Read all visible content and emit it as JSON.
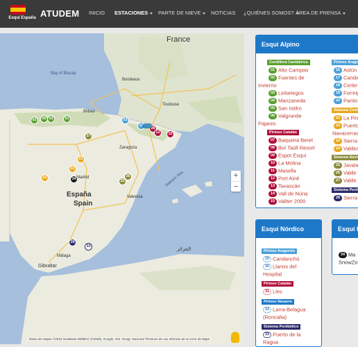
{
  "logo": {
    "text": "Esquí España"
  },
  "brand": "ATUDEM",
  "nav": [
    {
      "label": "INICIO",
      "dropdown": false,
      "active": false
    },
    {
      "label": "ESTACIONES",
      "dropdown": true,
      "active": true
    },
    {
      "label": "PARTE DE NIEVE",
      "dropdown": true,
      "active": false
    },
    {
      "label": "NOTICIAS",
      "dropdown": false,
      "active": false
    },
    {
      "label": "¿QUIÉNES SOMOS?",
      "dropdown": true,
      "active": false
    },
    {
      "label": "ÁREA DE PRENSA",
      "dropdown": true,
      "active": false
    }
  ],
  "map": {
    "labels": {
      "france": "France",
      "espana": "España",
      "spain": "Spain",
      "bay": "Bay of Biscay",
      "gibraltar": "Gibraltar",
      "balearic": "Balearic Sea",
      "madrid": "Madrid",
      "zaragoza": "Zaragoza",
      "valencia": "Valencia",
      "bilbao": "Bilbao",
      "toulouse": "Toulouse",
      "bordeaux": "Bordeaux",
      "malaga": "Málaga",
      "arabic": "الجزائر"
    },
    "markers": [
      {
        "n": "02",
        "color": "#5a9e2f"
      },
      {
        "n": "06",
        "color": "#5a9e2f"
      },
      {
        "n": "03",
        "color": "#5a9e2f"
      },
      {
        "n": "01",
        "color": "#5a9e2f"
      },
      {
        "n": "27",
        "color": "#8a8a3c"
      },
      {
        "n": "33",
        "color": "#4aa0d8"
      },
      {
        "n": "19",
        "color": "#4aa0d8"
      },
      {
        "n": "08",
        "color": "#b0103a"
      },
      {
        "n": "12",
        "color": "#b0103a"
      },
      {
        "n": "10",
        "color": "#b0103a"
      },
      {
        "n": "21",
        "color": "#e7a81e"
      },
      {
        "n": "22",
        "color": "#e7a81e"
      },
      {
        "n": "23",
        "color": "#e7a81e"
      },
      {
        "n": "34",
        "color": "#1a1a1a"
      },
      {
        "n": "25",
        "color": "#8a8a3c"
      },
      {
        "n": "26",
        "color": "#8a8a3c"
      },
      {
        "n": "28",
        "color": "#2a2a6a"
      },
      {
        "n": "33",
        "color": "#ffffff"
      }
    ],
    "attribution": "Datos de mapas ©2015 GeoBasis-DE/BKG (©2009), Google, Inst. Geogr. Nacional   Términos de uso   Informar de un error de Maps"
  },
  "alpino": {
    "title": "Esquí Alpino",
    "groups": [
      {
        "label": "Cordillera Cantábrica",
        "color": "#5a9e2f",
        "items": [
          {
            "n": "01",
            "name": "Alto Campoo"
          },
          {
            "n": "02",
            "name": "Fuentes de"
          },
          {
            "n": "",
            "name": "Invierno"
          },
          {
            "n": "03",
            "name": "Leitariegos"
          },
          {
            "n": "04",
            "name": "Manzaneda"
          },
          {
            "n": "05",
            "name": "San Isidro"
          },
          {
            "n": "06",
            "name": "Valgrande"
          },
          {
            "n": "",
            "name": "Pajares"
          }
        ]
      },
      {
        "label": "Pirineo Catalán",
        "color": "#b0103a",
        "items": [
          {
            "n": "07",
            "name": "Baqueira Beret"
          },
          {
            "n": "08",
            "name": "Boí Taüll Resort"
          },
          {
            "n": "09",
            "name": "Espot Esquí"
          },
          {
            "n": "10",
            "name": "La Molina"
          },
          {
            "n": "11",
            "name": "Masella"
          },
          {
            "n": "12",
            "name": "Port Ainé"
          },
          {
            "n": "13",
            "name": "Tavascán"
          },
          {
            "n": "14",
            "name": "Vall de Núria"
          },
          {
            "n": "15",
            "name": "Valiter 2000"
          }
        ]
      },
      {
        "label": "Pirineo Aragonés",
        "color": "#4aa0d8",
        "items": [
          {
            "n": "16",
            "name": "Astún"
          },
          {
            "n": "17",
            "name": "Canda"
          },
          {
            "n": "18",
            "name": "Cerler"
          },
          {
            "n": "19",
            "name": "Formig"
          },
          {
            "n": "20",
            "name": "Panticos"
          }
        ]
      },
      {
        "label": "Sistema Central",
        "color": "#e7a81e",
        "items": [
          {
            "n": "21",
            "name": "La Pinilla"
          },
          {
            "n": "22",
            "name": "Puerto"
          },
          {
            "n": "",
            "name": "Navacerrada"
          },
          {
            "n": "23",
            "name": "Sierra"
          },
          {
            "n": "24",
            "name": "Valdes"
          }
        ]
      },
      {
        "label": "Sistema Ibérico",
        "color": "#8a8a3c",
        "items": [
          {
            "n": "25",
            "name": "Javala"
          },
          {
            "n": "26",
            "name": "Valde"
          },
          {
            "n": "27",
            "name": "Valde"
          }
        ]
      },
      {
        "label": "Sistema Penibético",
        "color": "#2a2a6a",
        "items": [
          {
            "n": "28",
            "name": "Sierra"
          }
        ]
      }
    ]
  },
  "nordico": {
    "title": "Esquí Nórdico",
    "groups": [
      {
        "label": "Pirineo Aragonés",
        "color": "#4aa0d8",
        "items": [
          {
            "n": "29",
            "name": "Candanchú"
          },
          {
            "n": "30",
            "name": "Llanos del"
          },
          {
            "n": "",
            "name": "Hospital"
          }
        ]
      },
      {
        "label": "Pirineo Catalán",
        "color": "#b0103a",
        "items": [
          {
            "n": "31",
            "name": "Lles"
          }
        ]
      },
      {
        "label": "Pirineo Navarro",
        "color": "#1e78c8",
        "items": [
          {
            "n": "32",
            "name": "Larra-Belagua"
          },
          {
            "n": "",
            "name": "(Roncalia)"
          }
        ]
      },
      {
        "label": "Sistema Penibético",
        "color": "#2a2a6a",
        "items": [
          {
            "n": "33",
            "name": "Puerto de la"
          },
          {
            "n": "",
            "name": "Ragua"
          }
        ]
      }
    ]
  },
  "indoor": {
    "title": "Esquí Indoor",
    "items": [
      {
        "n": "34",
        "name": "Ma"
      },
      {
        "n": "",
        "name": "SnowZo"
      }
    ]
  }
}
